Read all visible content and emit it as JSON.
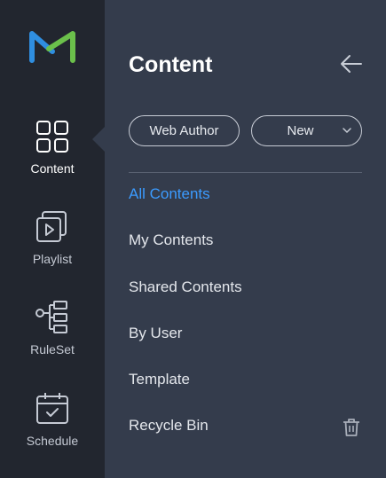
{
  "sidebar": {
    "logo": "m-logo-icon",
    "items": [
      {
        "label": "Content",
        "icon": "grid-icon",
        "active": true
      },
      {
        "label": "Playlist",
        "icon": "playlist-icon",
        "active": false
      },
      {
        "label": "RuleSet",
        "icon": "ruleset-icon",
        "active": false
      },
      {
        "label": "Schedule",
        "icon": "calendar-icon",
        "active": false
      }
    ]
  },
  "panel": {
    "title": "Content",
    "back_icon": "arrow-left-icon",
    "buttons": {
      "web_author": "Web Author",
      "new": "New"
    },
    "menu": [
      {
        "label": "All Contents",
        "active": true
      },
      {
        "label": "My Contents",
        "active": false
      },
      {
        "label": "Shared Contents",
        "active": false
      },
      {
        "label": "By User",
        "active": false
      },
      {
        "label": "Template",
        "active": false
      },
      {
        "label": "Recycle Bin",
        "active": false,
        "icon": "trash-icon"
      }
    ]
  },
  "colors": {
    "rail_bg": "#22262f",
    "panel_bg": "#343c4c",
    "accent": "#3b9bff",
    "logo_blue": "#2f8ee0",
    "logo_green": "#6bc04b"
  }
}
